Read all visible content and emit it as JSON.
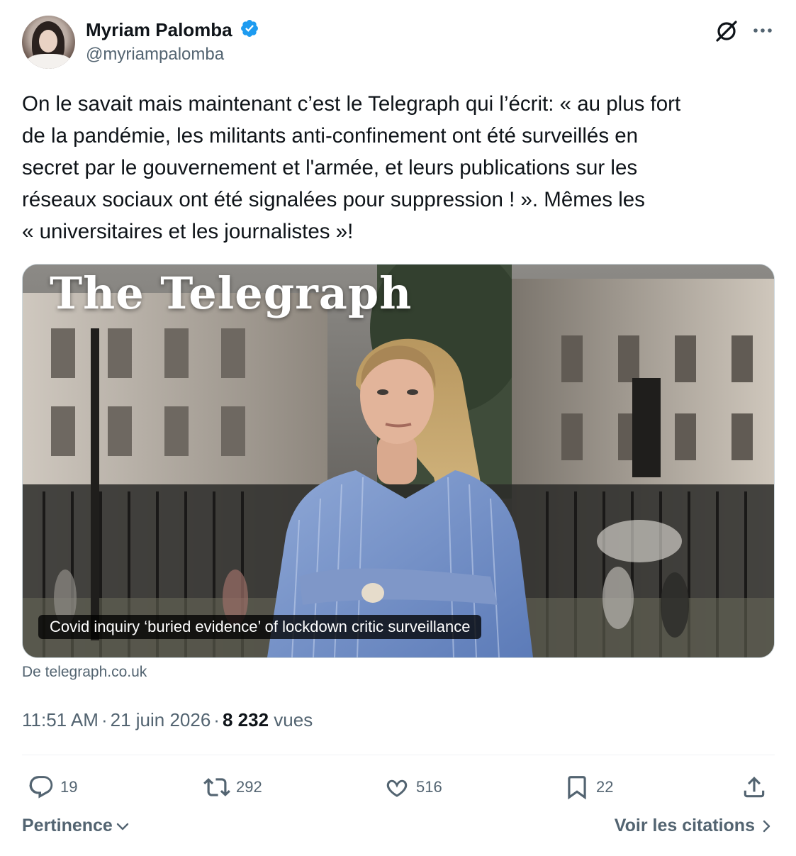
{
  "author": {
    "display_name": "Myriam Palomba",
    "handle": "@myriampalomba",
    "verified": true
  },
  "tweet": {
    "text": "On le savait mais maintenant c’est le Telegraph qui l’écrit: « au plus fort\nde la pandémie, les militants anti-confinement ont été surveillés en\nsecret par le gouvernement et l'armée, et leurs publications sur les\nréseaux sociaux ont été signalées pour suppression ! ». Mêmes les\n« universitaires et les journalistes »!",
    "card": {
      "masthead": "The Telegraph",
      "title": "Covid inquiry ‘buried evidence’ of lockdown critic surveillance",
      "source": "De telegraph.co.uk"
    },
    "time": "11:51 AM",
    "date": "21 juin 2026",
    "separator": "·",
    "views_count": "8 232",
    "views_label": "vues"
  },
  "actions": {
    "reply_count": "19",
    "retweet_count": "292",
    "like_count": "516",
    "bookmark_count": "22"
  },
  "footer": {
    "sort_label": "Pertinence",
    "quotes_label": "Voir les citations"
  },
  "colors": {
    "text_primary": "#0f1419",
    "text_secondary": "#536471",
    "verified_blue": "#1d9bf0",
    "divider": "#eff3f4"
  },
  "icons": {
    "grok": "grok-icon",
    "more": "more-icon",
    "reply": "reply-icon",
    "retweet": "retweet-icon",
    "like": "heart-icon",
    "bookmark": "bookmark-icon",
    "share": "share-icon"
  }
}
